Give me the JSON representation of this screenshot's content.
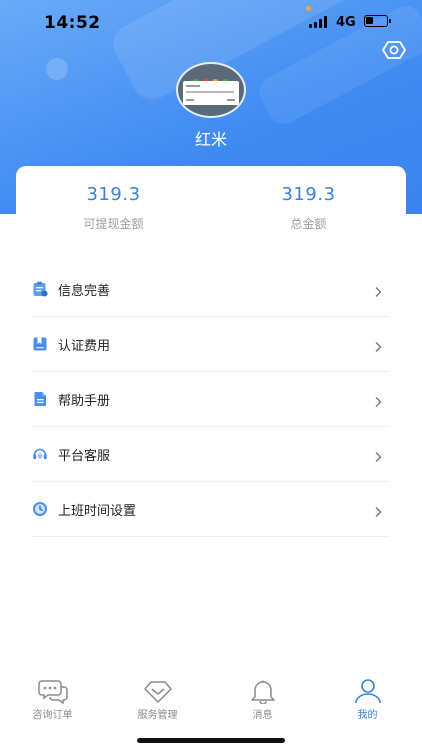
{
  "status_bar": {
    "time": "14:52",
    "network": "4G"
  },
  "profile": {
    "name": "红米"
  },
  "stats": [
    {
      "value": "319.3",
      "label": "可提现金额"
    },
    {
      "value": "319.3",
      "label": "总金额"
    }
  ],
  "menu": [
    {
      "label": "信息完善",
      "icon": "profile-info-icon"
    },
    {
      "label": "认证费用",
      "icon": "bookmark-book-icon"
    },
    {
      "label": "帮助手册",
      "icon": "document-icon"
    },
    {
      "label": "平台客服",
      "icon": "headset-icon"
    },
    {
      "label": "上班时间设置",
      "icon": "clock-icon"
    }
  ],
  "tabs": [
    {
      "label": "咨询订单",
      "icon": "chat-bubbles-icon",
      "active": false
    },
    {
      "label": "服务管理",
      "icon": "diamond-icon",
      "active": false
    },
    {
      "label": "消息",
      "icon": "bell-icon",
      "active": false
    },
    {
      "label": "我的",
      "icon": "user-icon",
      "active": true
    }
  ],
  "colors": {
    "accent": "#3a82d6",
    "header": "#4a90f0",
    "inactive": "#8a8a8a"
  }
}
